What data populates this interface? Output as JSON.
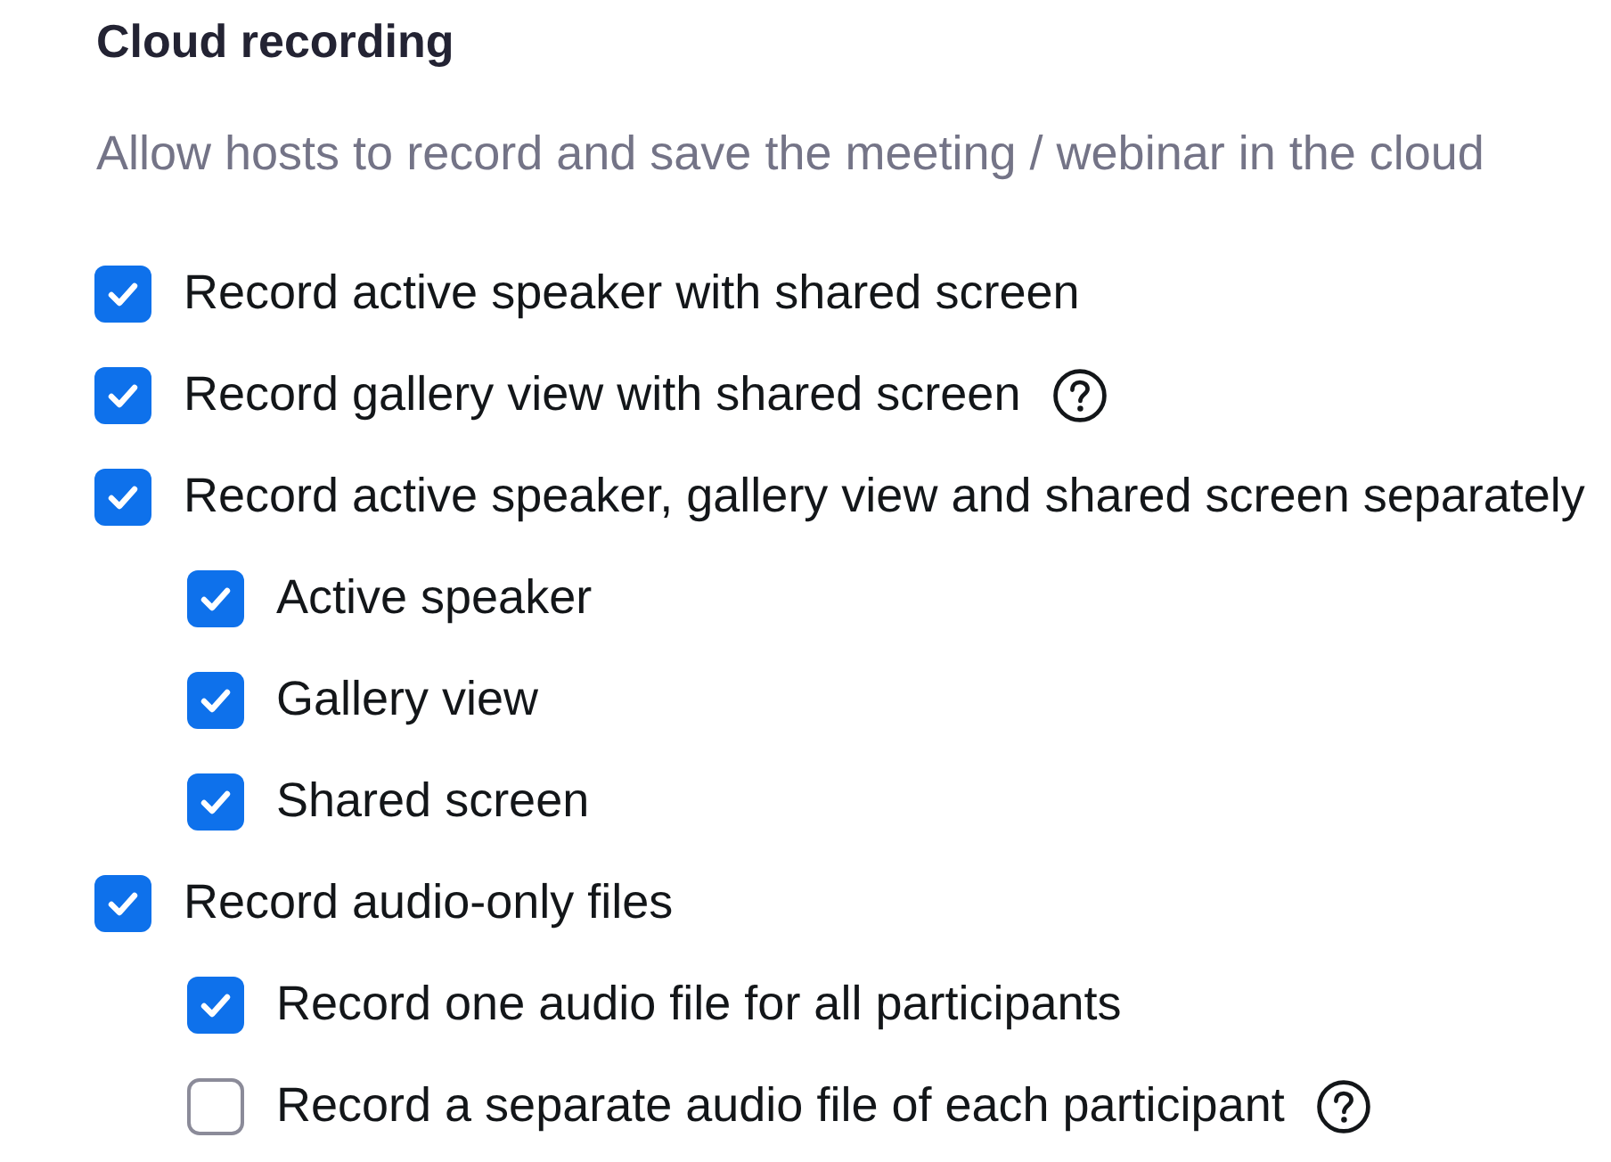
{
  "section": {
    "title": "Cloud recording",
    "description": "Allow hosts to record and save the meeting / webinar in the cloud"
  },
  "options": [
    {
      "label": "Record active speaker with shared screen",
      "checked": true,
      "help": false
    },
    {
      "label": "Record gallery view with shared screen",
      "checked": true,
      "help": true
    },
    {
      "label": "Record active speaker, gallery view and shared screen separately",
      "checked": true,
      "help": false,
      "children": [
        {
          "label": "Active speaker",
          "checked": true,
          "help": false
        },
        {
          "label": "Gallery view",
          "checked": true,
          "help": false
        },
        {
          "label": "Shared screen",
          "checked": true,
          "help": false
        }
      ]
    },
    {
      "label": "Record audio-only files",
      "checked": true,
      "help": false,
      "children": [
        {
          "label": "Record one audio file for all participants",
          "checked": true,
          "help": false
        },
        {
          "label": "Record a separate audio file of each participant",
          "checked": false,
          "help": true
        }
      ]
    }
  ]
}
